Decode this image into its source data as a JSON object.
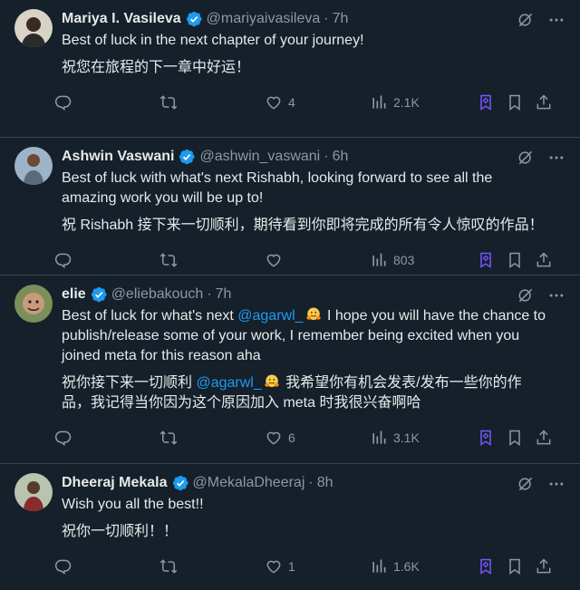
{
  "tweets": [
    {
      "name": "Mariya I. Vasileva",
      "handle": "@mariyaivasileva",
      "time": "7h",
      "text_en": "Best of luck in the next chapter of your journey!",
      "text_zh": "祝您在旅程的下一章中好运！",
      "likes": "4",
      "views": "2.1K"
    },
    {
      "name": "Ashwin Vaswani",
      "handle": "@ashwin_vaswani",
      "time": "6h",
      "text_en": "Best of luck with what's next Rishabh, looking forward to see all the amazing work you will be up to!",
      "text_zh": "祝 Rishabh 接下来一切顺利，期待看到你即将完成的所有令人惊叹的作品！",
      "likes": "",
      "views": "803"
    },
    {
      "name": "elie",
      "handle": "@eliebakouch",
      "time": "7h",
      "text_en_pre": "Best of luck for what's next ",
      "mention": "@agarwl_",
      "text_en_post": " I hope you will have the chance to publish/release some of your work, I remember being excited when you joined meta for this reason aha",
      "text_zh_pre": "祝你接下来一切顺利 ",
      "mention_zh": "@agarwl_",
      "text_zh_post": " 我希望你有机会发表/发布一些你的作品，我记得当你因为这个原因加入 meta 时我很兴奋啊哈",
      "likes": "6",
      "views": "3.1K"
    },
    {
      "name": "Dheeraj Mekala",
      "handle": "@MekalaDheeraj",
      "time": "8h",
      "text_en": "Wish you all the best!!",
      "text_zh": "祝你一切顺利！！",
      "likes": "1",
      "views": "1.6K"
    }
  ],
  "separator": "·",
  "icons": [
    "verified-badge-icon",
    "grok-icon",
    "more-icon",
    "reply-icon",
    "retweet-icon",
    "like-icon",
    "views-icon",
    "grok-analyze-icon",
    "bookmark-icon",
    "share-icon",
    "hugging-face-emoji"
  ],
  "colors": {
    "background": "#15202b",
    "text": "#e7e9ea",
    "muted": "#8b98a5",
    "accent": "#1d9bf0",
    "grok": "#7856ff"
  }
}
